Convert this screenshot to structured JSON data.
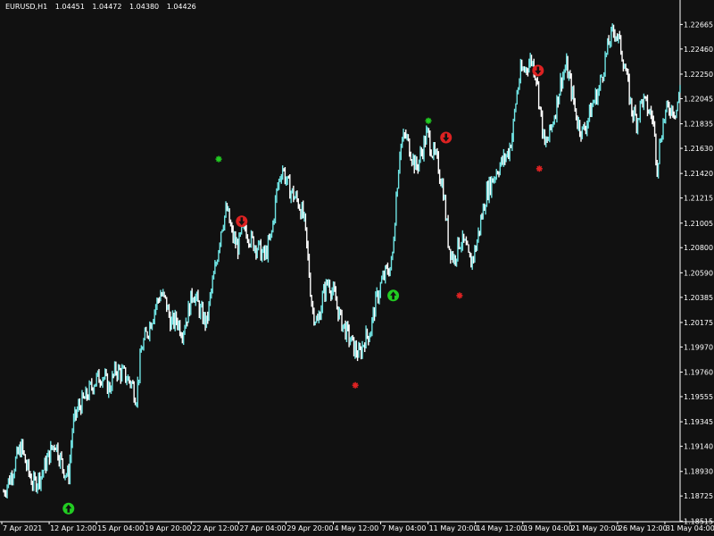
{
  "header": {
    "symbol": "EURUSD,H1",
    "open": "1.04451",
    "high": "1.04472",
    "low": "1.04380",
    "close": "1.04426"
  },
  "colors": {
    "background": "#111111",
    "candle_bull": "#6fe3e3",
    "candle_bear": "#ffffff",
    "axis": "#ffffff",
    "buy_marker": "#22cc22",
    "sell_marker": "#dd2222"
  },
  "chart_data": {
    "type": "line",
    "title": "",
    "xlabel": "",
    "ylabel": "",
    "grid": false,
    "x_ticks": [
      "7 Apr 2021",
      "12 Apr 12:00",
      "15 Apr 04:00",
      "19 Apr 20:00",
      "22 Apr 12:00",
      "27 Apr 04:00",
      "29 Apr 20:00",
      "4 May 12:00",
      "7 May 04:00",
      "11 May 20:00",
      "14 May 12:00",
      "19 May 04:00",
      "21 May 20:00",
      "26 May 12:00",
      "31 May 04:00"
    ],
    "y_ticks": [
      "1.22665",
      "1.22460",
      "1.22250",
      "1.22045",
      "1.21835",
      "1.21630",
      "1.21420",
      "1.21215",
      "1.21005",
      "1.20800",
      "1.20590",
      "1.20385",
      "1.20175",
      "1.19970",
      "1.19760",
      "1.19555",
      "1.19345",
      "1.19140",
      "1.18930",
      "1.18725",
      "1.18515"
    ],
    "ylim": [
      1.1851,
      1.2275
    ],
    "x_range": [
      0,
      1
    ],
    "series": [
      {
        "points": [
          [
            0.0,
            1.1876
          ],
          [
            0.01,
            1.1888
          ],
          [
            0.018,
            1.1902
          ],
          [
            0.026,
            1.1914
          ],
          [
            0.034,
            1.1897
          ],
          [
            0.044,
            1.1882
          ],
          [
            0.056,
            1.189
          ],
          [
            0.066,
            1.1905
          ],
          [
            0.076,
            1.1918
          ],
          [
            0.088,
            1.1896
          ],
          [
            0.096,
            1.1888
          ],
          [
            0.102,
            1.193
          ],
          [
            0.11,
            1.1946
          ],
          [
            0.122,
            1.1955
          ],
          [
            0.134,
            1.1968
          ],
          [
            0.146,
            1.1974
          ],
          [
            0.156,
            1.1962
          ],
          [
            0.166,
            1.1978
          ],
          [
            0.178,
            1.1974
          ],
          [
            0.19,
            1.1966
          ],
          [
            0.196,
            1.1954
          ],
          [
            0.204,
            1.1996
          ],
          [
            0.214,
            1.2012
          ],
          [
            0.224,
            1.203
          ],
          [
            0.232,
            1.2042
          ],
          [
            0.24,
            1.2034
          ],
          [
            0.248,
            1.2016
          ],
          [
            0.256,
            1.202
          ],
          [
            0.264,
            1.201
          ],
          [
            0.272,
            1.2024
          ],
          [
            0.28,
            1.2044
          ],
          [
            0.29,
            1.2028
          ],
          [
            0.3,
            1.2016
          ],
          [
            0.306,
            1.204
          ],
          [
            0.314,
            1.2066
          ],
          [
            0.322,
            1.2098
          ],
          [
            0.33,
            1.2112
          ],
          [
            0.338,
            1.209
          ],
          [
            0.346,
            1.208
          ],
          [
            0.356,
            1.2098
          ],
          [
            0.366,
            1.2086
          ],
          [
            0.376,
            1.208
          ],
          [
            0.386,
            1.2072
          ],
          [
            0.396,
            1.209
          ],
          [
            0.404,
            1.2128
          ],
          [
            0.412,
            1.2148
          ],
          [
            0.42,
            1.2132
          ],
          [
            0.428,
            1.2124
          ],
          [
            0.436,
            1.2118
          ],
          [
            0.444,
            1.2104
          ],
          [
            0.45,
            1.207
          ],
          [
            0.456,
            1.203
          ],
          [
            0.464,
            1.2016
          ],
          [
            0.472,
            1.204
          ],
          [
            0.48,
            1.2052
          ],
          [
            0.49,
            1.2038
          ],
          [
            0.498,
            1.202
          ],
          [
            0.508,
            1.2008
          ],
          [
            0.518,
            1.1996
          ],
          [
            0.526,
            1.199
          ],
          [
            0.534,
            1.2004
          ],
          [
            0.542,
            1.201
          ],
          [
            0.55,
            1.2034
          ],
          [
            0.558,
            1.205
          ],
          [
            0.566,
            1.206
          ],
          [
            0.574,
            1.2066
          ],
          [
            0.58,
            1.212
          ],
          [
            0.586,
            1.2164
          ],
          [
            0.594,
            1.2174
          ],
          [
            0.602,
            1.216
          ],
          [
            0.61,
            1.2146
          ],
          [
            0.618,
            1.216
          ],
          [
            0.626,
            1.2176
          ],
          [
            0.634,
            1.216
          ],
          [
            0.642,
            1.215
          ],
          [
            0.65,
            1.2128
          ],
          [
            0.658,
            1.2082
          ],
          [
            0.666,
            1.207
          ],
          [
            0.674,
            1.2086
          ],
          [
            0.682,
            1.2082
          ],
          [
            0.69,
            1.2066
          ],
          [
            0.698,
            1.208
          ],
          [
            0.706,
            1.2104
          ],
          [
            0.714,
            1.2126
          ],
          [
            0.722,
            1.2136
          ],
          [
            0.73,
            1.2146
          ],
          [
            0.738,
            1.2152
          ],
          [
            0.746,
            1.216
          ],
          [
            0.752,
            1.2174
          ],
          [
            0.758,
            1.2206
          ],
          [
            0.764,
            1.2226
          ],
          [
            0.772,
            1.223
          ],
          [
            0.78,
            1.2238
          ],
          [
            0.788,
            1.2222
          ],
          [
            0.794,
            1.219
          ],
          [
            0.8,
            1.2164
          ],
          [
            0.808,
            1.2176
          ],
          [
            0.816,
            1.2196
          ],
          [
            0.824,
            1.222
          ],
          [
            0.832,
            1.2232
          ],
          [
            0.84,
            1.221
          ],
          [
            0.848,
            1.2186
          ],
          [
            0.856,
            1.2176
          ],
          [
            0.864,
            1.2188
          ],
          [
            0.872,
            1.2202
          ],
          [
            0.88,
            1.2212
          ],
          [
            0.888,
            1.2234
          ],
          [
            0.896,
            1.2254
          ],
          [
            0.904,
            1.2262
          ],
          [
            0.912,
            1.2248
          ],
          [
            0.92,
            1.2226
          ],
          [
            0.928,
            1.2196
          ],
          [
            0.936,
            1.2186
          ],
          [
            0.944,
            1.2204
          ],
          [
            0.952,
            1.2196
          ],
          [
            0.96,
            1.2188
          ],
          [
            0.966,
            1.2148
          ],
          [
            0.972,
            1.2176
          ],
          [
            0.978,
            1.2192
          ],
          [
            0.986,
            1.2198
          ],
          [
            0.994,
            1.2194
          ],
          [
            1.0,
            1.2212
          ]
        ]
      }
    ],
    "markers": [
      {
        "kind": "buy-arrow",
        "x": 0.096,
        "y": 1.1862
      },
      {
        "kind": "buy-star",
        "x": 0.318,
        "y": 1.2154
      },
      {
        "kind": "sell-arrow",
        "x": 0.352,
        "y": 1.2102
      },
      {
        "kind": "sell-star",
        "x": 0.52,
        "y": 1.1965
      },
      {
        "kind": "buy-arrow",
        "x": 0.576,
        "y": 1.204
      },
      {
        "kind": "buy-star",
        "x": 0.628,
        "y": 1.2186
      },
      {
        "kind": "sell-arrow",
        "x": 0.654,
        "y": 1.2172
      },
      {
        "kind": "sell-star",
        "x": 0.674,
        "y": 1.204
      },
      {
        "kind": "sell-arrow",
        "x": 0.79,
        "y": 1.2228
      },
      {
        "kind": "sell-star",
        "x": 0.792,
        "y": 1.2146
      }
    ]
  }
}
